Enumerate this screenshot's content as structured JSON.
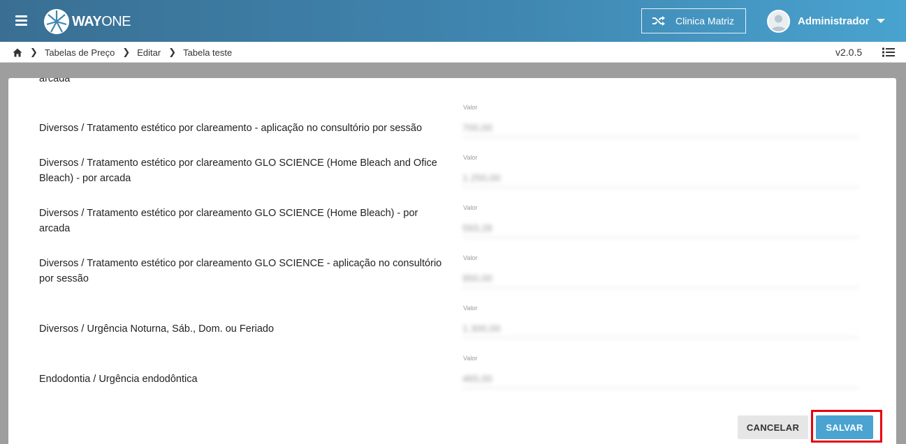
{
  "header": {
    "logo_bold": "WAY",
    "logo_light": "ONE",
    "clinic_label": "Clinica Matriz",
    "user_name": "Administrador"
  },
  "breadcrumb": {
    "items": [
      "Tabelas de Preço",
      "Editar",
      "Tabela teste"
    ],
    "version": "v2.0.5"
  },
  "form": {
    "partial_top_label": "arcada",
    "value_caption": "Valor",
    "rows": [
      {
        "label": "Diversos / Tratamento estético por clareamento - aplicação no consultório por sessão",
        "value": "700,00"
      },
      {
        "label": "Diversos / Tratamento estético por clareamento GLO SCIENCE (Home Bleach and Ofice Bleach) - por arcada",
        "value": "1.250,00"
      },
      {
        "label": "Diversos / Tratamento estético por clareamento GLO SCIENCE (Home Bleach) - por arcada",
        "value": "593,28"
      },
      {
        "label": "Diversos / Tratamento estético por clareamento GLO SCIENCE - aplicação no consultório por sessão",
        "value": "950,00"
      },
      {
        "label": "Diversos / Urgência Noturna, Sáb., Dom. ou Feriado",
        "value": "1.300,00"
      },
      {
        "label": "Endodontia / Urgência endodôntica",
        "value": "465,00"
      }
    ]
  },
  "actions": {
    "cancel_label": "CANCELAR",
    "save_label": "SALVAR"
  },
  "colors": {
    "header_start": "#3a6f93",
    "header_end": "#49a3cf",
    "save_button": "#4aa3d1",
    "highlight": "#e8000b"
  },
  "icons": [
    "menu-icon",
    "logo-icon",
    "shuffle-icon",
    "user-avatar-icon",
    "chevron-down-icon",
    "home-icon",
    "chevron-right-icon",
    "list-icon"
  ]
}
